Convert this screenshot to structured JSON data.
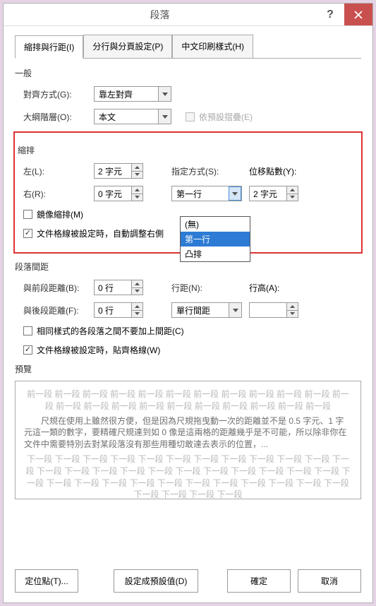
{
  "title": "段落",
  "tabs": {
    "t1": "縮排與行距(I)",
    "t2": "分行與分頁設定(P)",
    "t3": "中文印刷樣式(H)"
  },
  "general": {
    "label": "一般",
    "align_label": "對齊方式(G):",
    "align_value": "靠左對齊",
    "outline_label": "大綱階層(O):",
    "outline_value": "本文",
    "collapsed_label": "依預設摺疊(E)"
  },
  "indent": {
    "label": "縮排",
    "left_label": "左(L):",
    "left_value": "2 字元",
    "right_label": "右(R):",
    "right_value": "0 字元",
    "special_label": "指定方式(S):",
    "special_value": "第一行",
    "by_label": "位移點數(Y):",
    "by_value": "2 字元",
    "mirror_label": "鏡像縮排(M)",
    "auto_label": "文件格線被設定時，自動調整右側",
    "options": {
      "none": "(無)",
      "first": "第一行",
      "hang": "凸排"
    }
  },
  "spacing": {
    "label": "段落間距",
    "before_label": "與前段距離(B):",
    "before_value": "0 行",
    "after_label": "與後段距離(F):",
    "after_value": "0 行",
    "line_label": "行距(N):",
    "line_value": "單行間距",
    "at_label": "行高(A):",
    "at_value": "",
    "nospace_label": "相同樣式的各段落之間不要加上間距(C)",
    "snap_label": "文件格線被設定時，貼齊格線(W)"
  },
  "preview": {
    "label": "預覽",
    "prev_line": "前一段 前一段 前一段 前一段 前一段 前一段 前一段 前一段 前一段 前一段 前一段 前一段 前一段 前一段 前一段 前一段 前一段 前一段 前一段 前一段 前一段 前一段",
    "body": "尺規在使用上雖然很方便，但是因為尺規拖曳動一次的距離並不是 0.5 字元、1 字元這一類的數字，要精確尺規達到如 0 像是這兩格的距離幾乎是不可能，所以除非你在文件中需要特別去對某段落沒有那些用種切敢達去表示的位置，...",
    "next_line": "下一段 下一段 下一段 下一段 下一段 下一段 下一段 下一段 下一段 下一段 下一段 下一段 下一段 下一段 下一段 下一段 下一段 下一段 下一段 下一段 下一段 下一段 下一段 下一段 下一段 下一段 下一段 下一段 下一段 下一段 下一段 下一段 下一段 下一段 下一段 下一段 下一段 下一段 下一段"
  },
  "buttons": {
    "tabs_btn": "定位點(T)...",
    "default_btn": "設定成預設值(D)",
    "ok": "確定",
    "cancel": "取消"
  }
}
